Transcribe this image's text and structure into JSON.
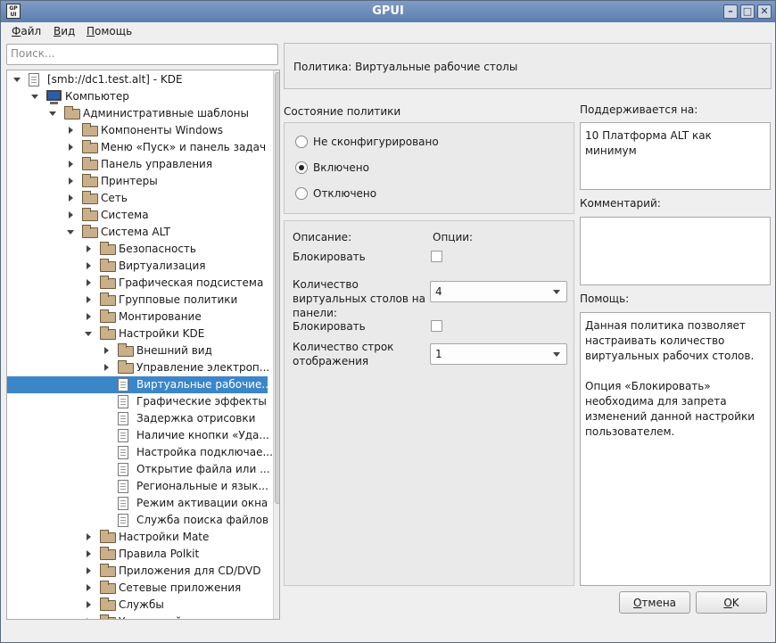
{
  "window": {
    "title": "GPUI",
    "app_icon_text": "GP UI"
  },
  "menu": {
    "file": {
      "underlined": "Ф",
      "rest": "айл"
    },
    "view": {
      "underlined": "В",
      "rest": "ид"
    },
    "help": {
      "underlined": "П",
      "rest": "омощь"
    }
  },
  "search": {
    "placeholder": "Поиск..."
  },
  "tree": {
    "items": [
      {
        "label": "[smb://dc1.test.alt] - KDE",
        "icon": "document-icon",
        "expanded": true
      },
      {
        "label": "Компьютер",
        "icon": "computer-icon",
        "expanded": true
      },
      {
        "label": "Административные шаблоны",
        "icon": "folder-icon",
        "expanded": true
      },
      {
        "label": "Компоненты Windows",
        "icon": "folder-icon",
        "expanded": false
      },
      {
        "label": "Меню «Пуск» и панель задач",
        "icon": "folder-icon",
        "expanded": false
      },
      {
        "label": "Панель управления",
        "icon": "folder-icon",
        "expanded": false
      },
      {
        "label": "Принтеры",
        "icon": "folder-icon",
        "expanded": false
      },
      {
        "label": "Сеть",
        "icon": "folder-icon",
        "expanded": false
      },
      {
        "label": "Система",
        "icon": "folder-icon",
        "expanded": false
      },
      {
        "label": "Система ALT",
        "icon": "folder-icon",
        "expanded": true
      },
      {
        "label": "Безопасность",
        "icon": "folder-icon",
        "expanded": false
      },
      {
        "label": "Виртуализация",
        "icon": "folder-icon",
        "expanded": false
      },
      {
        "label": "Графическая подсистема",
        "icon": "folder-icon",
        "expanded": false
      },
      {
        "label": "Групповые политики",
        "icon": "folder-icon",
        "expanded": false
      },
      {
        "label": "Монтирование",
        "icon": "folder-icon",
        "expanded": false
      },
      {
        "label": "Настройки KDE",
        "icon": "folder-icon",
        "expanded": true
      },
      {
        "label": "Внешний вид",
        "icon": "folder-icon",
        "expanded": false
      },
      {
        "label": "Управление электроп...",
        "icon": "folder-icon",
        "expanded": false
      },
      {
        "label": "Виртуальные рабочие...",
        "icon": "document-icon",
        "selected": true
      },
      {
        "label": "Графические эффекты",
        "icon": "document-icon"
      },
      {
        "label": "Задержка отрисовки",
        "icon": "document-icon"
      },
      {
        "label": "Наличие кнопки «Уда...",
        "icon": "document-icon"
      },
      {
        "label": "Настройка подключае...",
        "icon": "document-icon"
      },
      {
        "label": "Открытие файла или ...",
        "icon": "document-icon"
      },
      {
        "label": "Региональные и язык...",
        "icon": "document-icon"
      },
      {
        "label": "Режим активации окна",
        "icon": "document-icon"
      },
      {
        "label": "Служба поиска файлов",
        "icon": "document-icon"
      },
      {
        "label": "Настройки Mate",
        "icon": "folder-icon",
        "expanded": false
      },
      {
        "label": "Правила Polkit",
        "icon": "folder-icon",
        "expanded": false
      },
      {
        "label": "Приложения для CD/DVD",
        "icon": "folder-icon",
        "expanded": false
      },
      {
        "label": "Сетевые приложения",
        "icon": "folder-icon",
        "expanded": false
      },
      {
        "label": "Службы",
        "icon": "folder-icon",
        "expanded": false
      },
      {
        "label": "Удаленный доступ через...",
        "icon": "folder-icon",
        "expanded": false
      }
    ]
  },
  "policy": {
    "header": "Политика: Виртуальные рабочие столы",
    "state_title": "Состояние политики",
    "states": [
      {
        "label": "Не сконфигурировано",
        "checked": false
      },
      {
        "label": "Включено",
        "checked": true
      },
      {
        "label": "Отключено",
        "checked": false
      }
    ],
    "supported_title": "Поддерживается на:",
    "supported_value": "10 Платформа ALT как минимум",
    "comment_title": "Комментарий:",
    "comment_value": "",
    "help_title": "Помощь:",
    "help_text": "Данная политика позволяет настраивать количество виртуальных рабочих столов.\n\nОпция «Блокировать» необходима для запрета изменений данной настройки пользователем."
  },
  "options": {
    "description_header": "Описание:",
    "options_header": "Опции:",
    "rows": [
      {
        "label": "Блокировать",
        "type": "checkbox",
        "checked": false
      },
      {
        "label": "Количество виртуальных столов на панели:",
        "type": "combo",
        "value": "4"
      },
      {
        "label": "Блокировать",
        "type": "checkbox",
        "checked": false
      },
      {
        "label": "Количество строк отображения",
        "type": "combo",
        "value": "1"
      }
    ]
  },
  "buttons": {
    "cancel": {
      "underlined": "О",
      "rest": "тмена"
    },
    "ok": {
      "underlined": "O",
      "rest": "K"
    }
  }
}
